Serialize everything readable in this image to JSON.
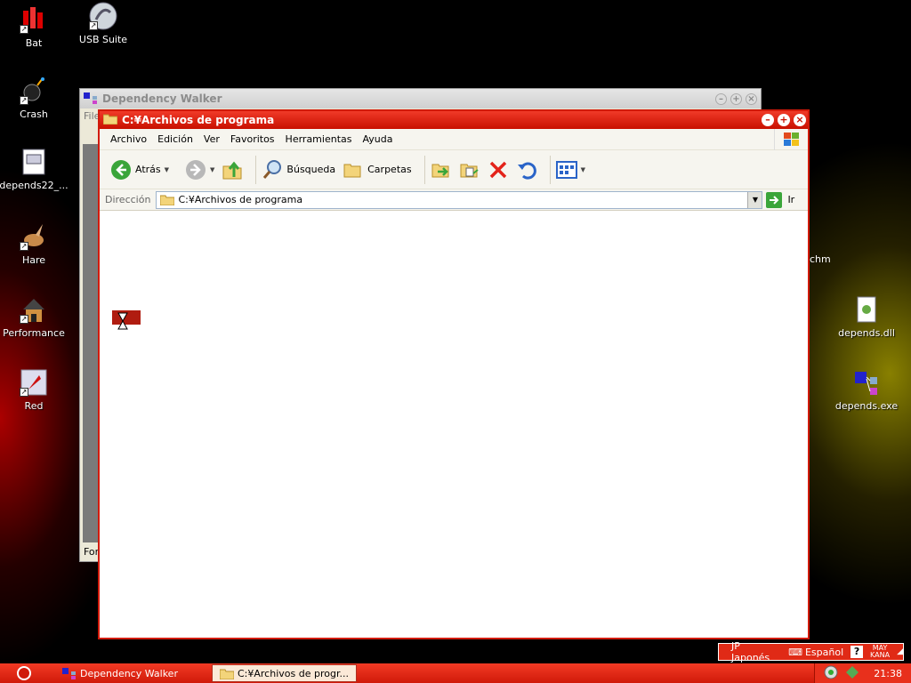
{
  "desktop": {
    "icons": [
      {
        "label": "Bat"
      },
      {
        "label": "USB Suite"
      },
      {
        "label": "Crash"
      },
      {
        "label": "depends22_..."
      },
      {
        "label": "Hare"
      },
      {
        "label": "Performance"
      },
      {
        "label": "Red"
      },
      {
        "label": "depends.dll"
      },
      {
        "label": "depends.exe"
      }
    ],
    "partial_label": "chm"
  },
  "dw_window": {
    "title": "Dependency Walker",
    "menu_partial": "File",
    "status_partial": "For"
  },
  "explorer": {
    "title": "C:¥Archivos de programa",
    "menu": [
      "Archivo",
      "Edición",
      "Ver",
      "Favoritos",
      "Herramientas",
      "Ayuda"
    ],
    "toolbar": {
      "back": "Atrás",
      "search": "Búsqueda",
      "folders": "Carpetas"
    },
    "address": {
      "label": "Dirección",
      "value": "C:¥Archivos de programa",
      "go": "Ir"
    }
  },
  "taskbar": {
    "tasks": [
      {
        "label": "Dependency Walker"
      },
      {
        "label": "C:¥Archivos de progr..."
      }
    ],
    "clock": "21:38"
  },
  "language_bar": {
    "language": "JP Japonés",
    "keyboard": "Español",
    "mode_top": "MAY",
    "mode_bottom": "KANA"
  }
}
